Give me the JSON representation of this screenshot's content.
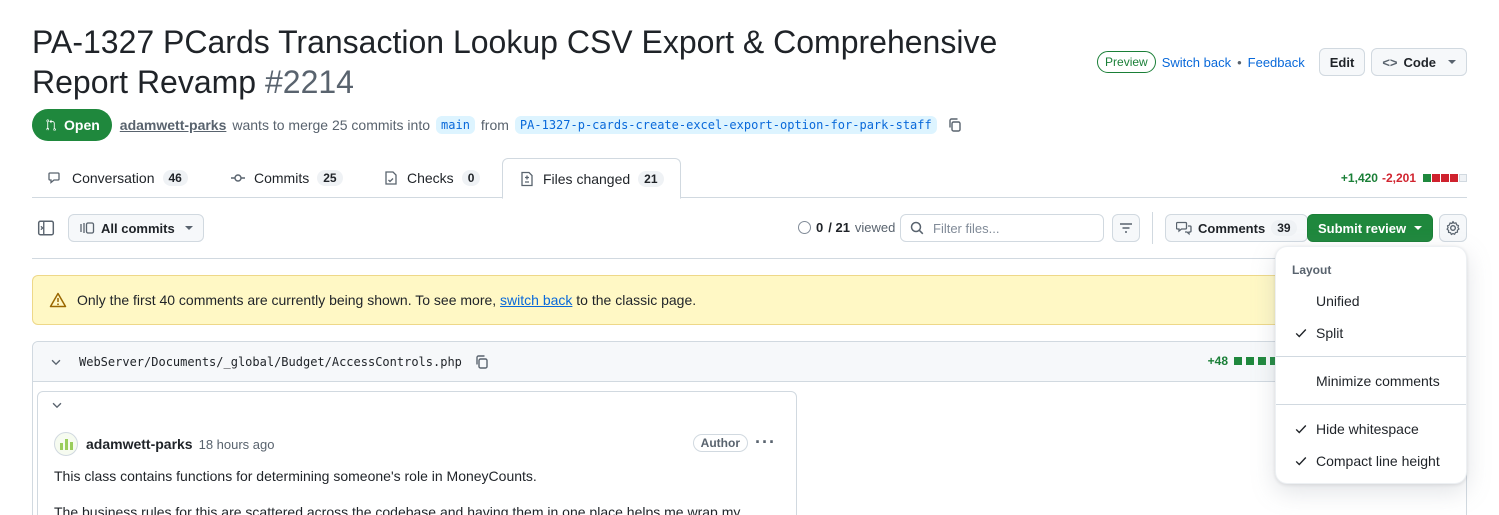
{
  "pr": {
    "title": "PA-1327 PCards Transaction Lookup CSV Export & Comprehensive Report Revamp",
    "number": "#2214",
    "state": "Open",
    "author": "adamwett-parks",
    "merge_text": "wants to merge 25 commits into",
    "base_branch": "main",
    "from_text": "from",
    "head_branch": "PA-1327-p-cards-create-excel-export-option-for-park-staff"
  },
  "header": {
    "preview_label": "Preview",
    "switch_back_label": "Switch back",
    "separator": "•",
    "feedback_label": "Feedback",
    "edit_label": "Edit",
    "code_label": "Code"
  },
  "tabs": [
    {
      "label": "Conversation",
      "count": "46",
      "icon": "comment-discussion-icon"
    },
    {
      "label": "Commits",
      "count": "25",
      "icon": "git-commit-icon"
    },
    {
      "label": "Checks",
      "count": "0",
      "icon": "checklist-icon"
    },
    {
      "label": "Files changed",
      "count": "21",
      "icon": "file-diff-icon"
    }
  ],
  "diffstat": {
    "additions": "+1,420",
    "deletions": "-2,201"
  },
  "toolbar": {
    "all_commits_label": "All commits",
    "viewed_count": "0",
    "viewed_total": "/ 21",
    "viewed_label": "viewed",
    "filter_placeholder": "Filter files...",
    "comments_label": "Comments",
    "comments_count": "39",
    "submit_label": "Submit review"
  },
  "warning": {
    "text_before": "Only the first 40 comments are currently being shown. To see more,",
    "link": "switch back",
    "text_after": "to the classic page."
  },
  "file": {
    "path": "WebServer/Documents/_global/Budget/AccessControls.php",
    "additions": "+48"
  },
  "comment": {
    "author": "adamwett-parks",
    "time": "18 hours ago",
    "badge": "Author",
    "paragraph1": "This class contains functions for determining someone's role in MoneyCounts.",
    "paragraph2": "The business rules for this are scattered across the codebase and having them in one place helps me wrap my"
  },
  "menu": {
    "section_title": "Layout",
    "items": [
      {
        "label": "Unified",
        "checked": false
      },
      {
        "label": "Split",
        "checked": true
      },
      {
        "label": "Minimize comments",
        "checked": false
      },
      {
        "label": "Hide whitespace",
        "checked": true
      },
      {
        "label": "Compact line height",
        "checked": true
      }
    ]
  },
  "colors": {
    "accent": "#0969da",
    "success": "#1f883d",
    "danger": "#d1242f",
    "warning_bg": "#fff8c5"
  }
}
